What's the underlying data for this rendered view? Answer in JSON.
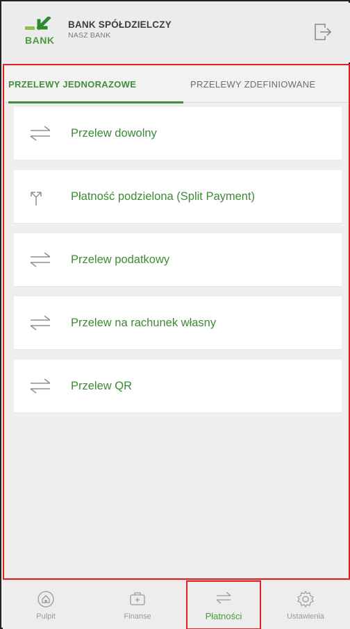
{
  "header": {
    "logo_text": "BANK",
    "bank_name": "BANK SPÓŁDZIELCZY",
    "bank_subtitle": "NASZ BANK",
    "logout_icon": "logout-icon"
  },
  "tabs": [
    {
      "label": "PRZELEWY JEDNORAZOWE",
      "active": true
    },
    {
      "label": "PRZELEWY ZDEFINIOWANE",
      "active": false
    }
  ],
  "transfer_options": [
    {
      "label": "Przelew dowolny",
      "icon": "transfer-arrows-icon"
    },
    {
      "label": "Płatność podzielona (Split Payment)",
      "icon": "split-payment-icon"
    },
    {
      "label": "Przelew podatkowy",
      "icon": "transfer-arrows-icon"
    },
    {
      "label": "Przelew na rachunek własny",
      "icon": "transfer-arrows-icon"
    },
    {
      "label": "Przelew QR",
      "icon": "transfer-arrows-icon"
    }
  ],
  "bottom_nav": [
    {
      "label": "Pulpit",
      "icon": "home-icon",
      "active": false
    },
    {
      "label": "Finanse",
      "icon": "wallet-icon",
      "active": false
    },
    {
      "label": "Płatności",
      "icon": "transfer-arrows-icon",
      "active": true
    },
    {
      "label": "Ustawienia",
      "icon": "gear-icon",
      "active": false
    }
  ],
  "colors": {
    "accent_green": "#3f8f3a",
    "highlight_red": "#e02020",
    "background": "#efefef"
  }
}
